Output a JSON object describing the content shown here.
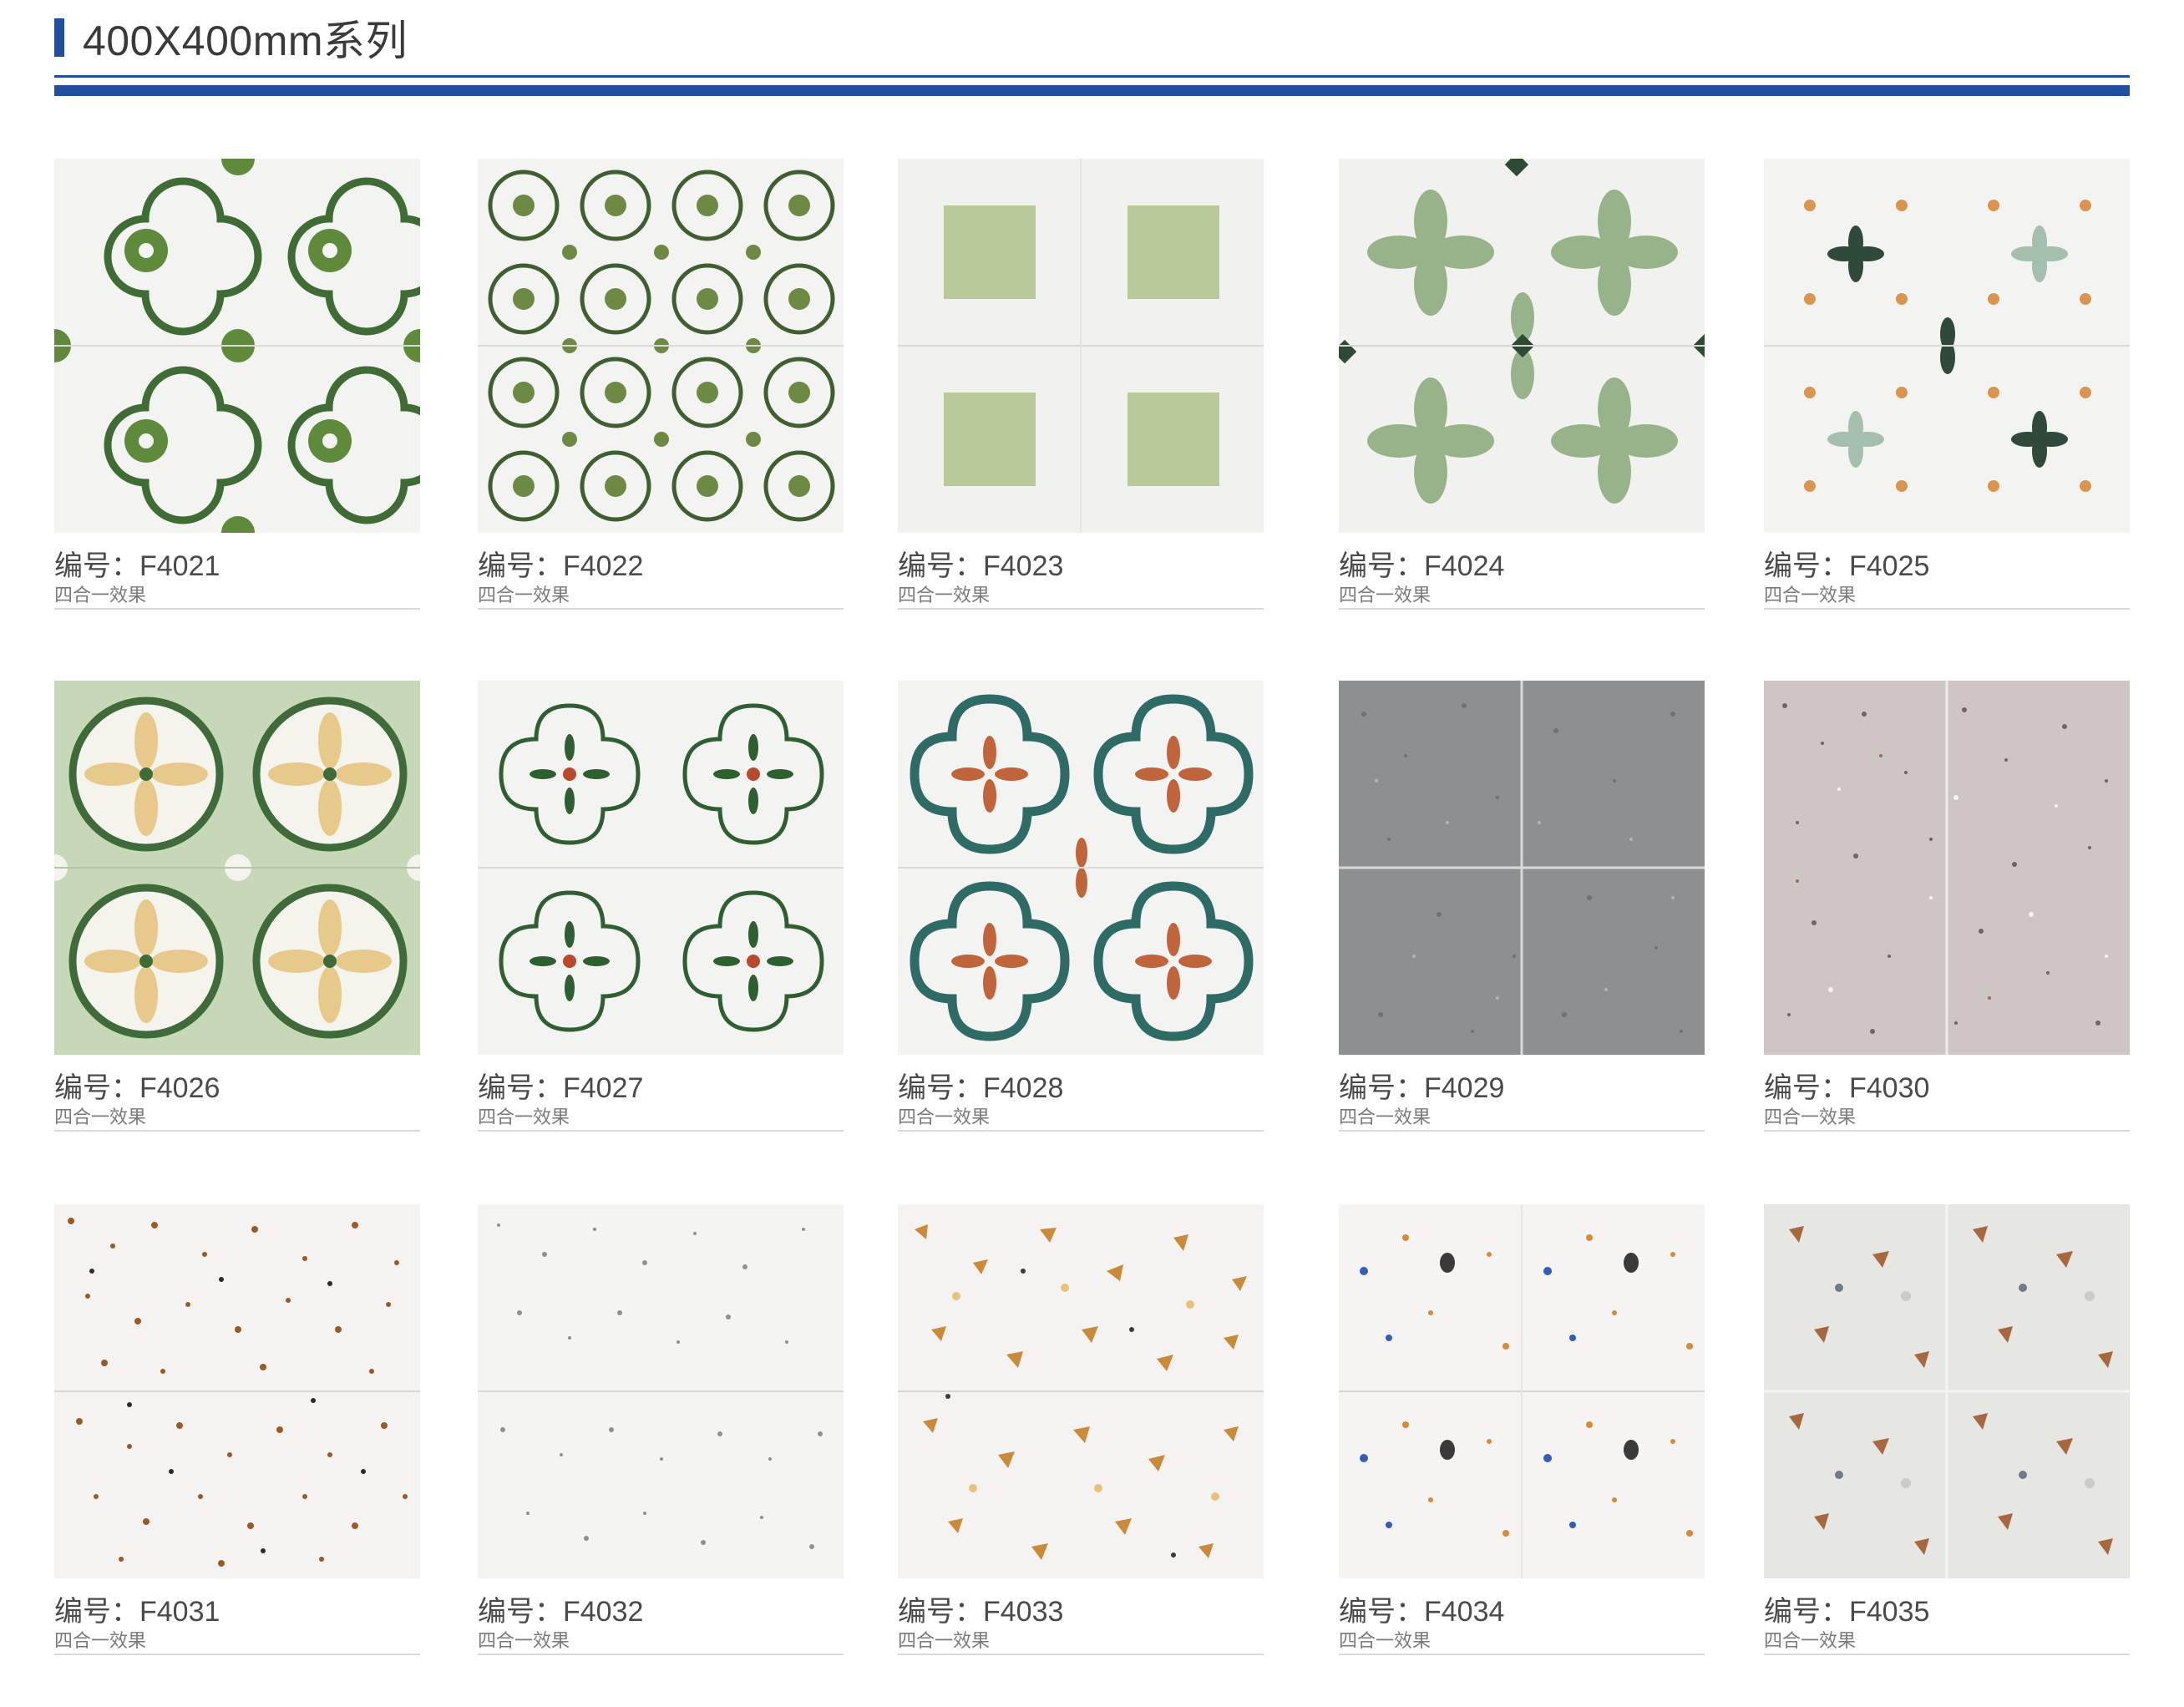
{
  "header": {
    "title": "400X400mm系列"
  },
  "caption_prefix": "编号：",
  "products": [
    {
      "code": "F4021",
      "sub": "四合一效果",
      "pattern": "f4021-tile-icon"
    },
    {
      "code": "F4022",
      "sub": "四合一效果",
      "pattern": "f4022-tile-icon"
    },
    {
      "code": "F4023",
      "sub": "四合一效果",
      "pattern": "f4023-tile-icon"
    },
    {
      "code": "F4024",
      "sub": "四合一效果",
      "pattern": "f4024-tile-icon"
    },
    {
      "code": "F4025",
      "sub": "四合一效果",
      "pattern": "f4025-tile-icon"
    },
    {
      "code": "F4026",
      "sub": "四合一效果",
      "pattern": "f4026-tile-icon"
    },
    {
      "code": "F4027",
      "sub": "四合一效果",
      "pattern": "f4027-tile-icon"
    },
    {
      "code": "F4028",
      "sub": "四合一效果",
      "pattern": "f4028-tile-icon"
    },
    {
      "code": "F4029",
      "sub": "四合一效果",
      "pattern": "f4029-tile-icon"
    },
    {
      "code": "F4030",
      "sub": "四合一效果",
      "pattern": "f4030-tile-icon"
    },
    {
      "code": "F4031",
      "sub": "四合一效果",
      "pattern": "f4031-tile-icon"
    },
    {
      "code": "F4032",
      "sub": "四合一效果",
      "pattern": "f4032-tile-icon"
    },
    {
      "code": "F4033",
      "sub": "四合一效果",
      "pattern": "f4033-tile-icon"
    },
    {
      "code": "F4034",
      "sub": "四合一效果",
      "pattern": "f4034-tile-icon"
    },
    {
      "code": "F4035",
      "sub": "四合一效果",
      "pattern": "f4035-tile-icon"
    }
  ],
  "colors": {
    "accent": "#1f4f9e"
  }
}
